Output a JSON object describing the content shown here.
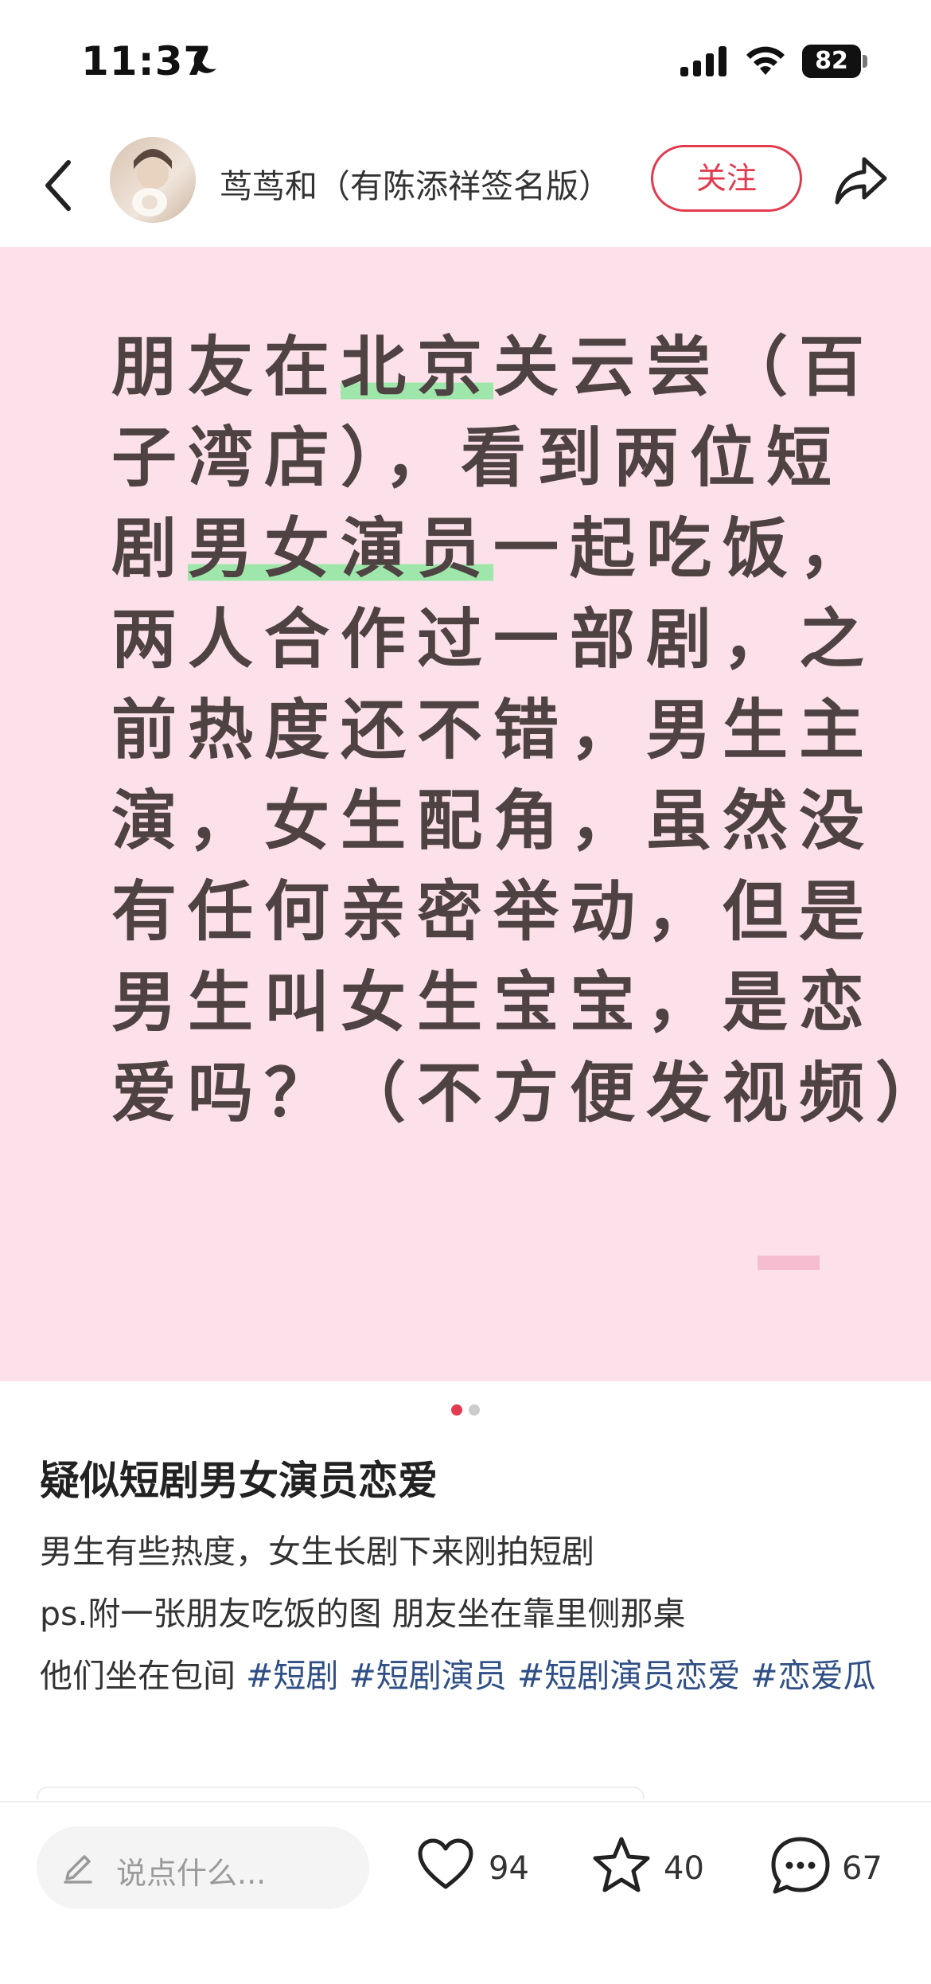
{
  "status_bar": {
    "time": "11:37",
    "battery": "82"
  },
  "header": {
    "author": "茑茑和（有陈添祥签名版）",
    "follow_label": "关注"
  },
  "image": {
    "lines": [
      [
        {
          "t": "朋友在"
        },
        {
          "t": "北京",
          "hl": true
        },
        {
          "t": "关云尝（百"
        }
      ],
      [
        {
          "t": "子湾店），看到两位短"
        }
      ],
      [
        {
          "t": "剧"
        },
        {
          "t": "男女演员",
          "hl": true
        },
        {
          "t": "一起吃饭，"
        }
      ],
      [
        {
          "t": "两人合作过一部剧，之"
        }
      ],
      [
        {
          "t": "前热度还不错，男生主"
        }
      ],
      [
        {
          "t": "演，女生配角，虽然没"
        }
      ],
      [
        {
          "t": "有任何亲密举动，但是"
        }
      ],
      [
        {
          "t": "男生叫女生宝宝，是恋"
        }
      ],
      [
        {
          "t": "爱吗？（不方便发视频）"
        }
      ]
    ],
    "highlight_color": "#9fe6ab",
    "background_color": "#fde1ea"
  },
  "carousel": {
    "total": 2,
    "active": 0,
    "active_color": "#e23b4e",
    "inactive_color": "#cccccc"
  },
  "post": {
    "title": "疑似短剧男女演员恋爱",
    "line1": "男生有些热度，女生长剧下来刚拍短剧",
    "line2": "ps.附一张朋友吃饭的图 朋友坐在靠里侧那桌",
    "line3_text": "他们坐在包间 ",
    "tags": [
      "#短剧",
      "#短剧演员",
      "#短剧演员恋爱",
      "#恋爱瓜"
    ]
  },
  "bottom_bar": {
    "comment_placeholder": "说点什么...",
    "likes": "94",
    "collects": "40",
    "comments": "67",
    "icons": [
      "pencil-icon",
      "heart-icon",
      "star-icon",
      "comment-icon"
    ]
  }
}
